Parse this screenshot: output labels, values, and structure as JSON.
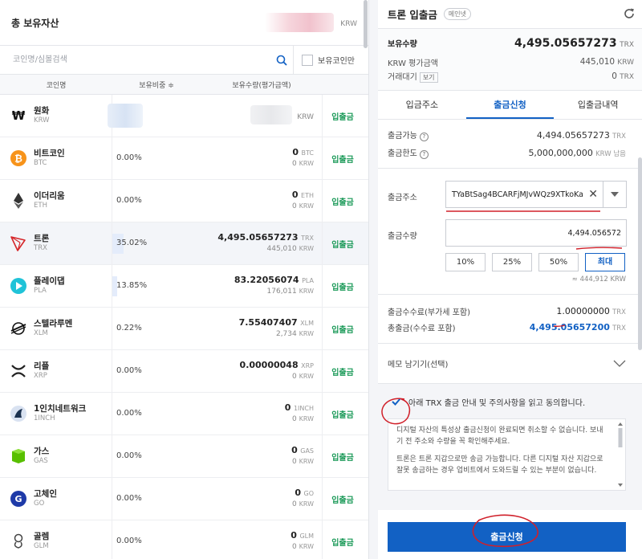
{
  "left": {
    "header_title": "총 보유자산",
    "header_currency": "KRW",
    "search_placeholder": "코인명/심볼검색",
    "owned_only_label": "보유코인만",
    "columns": [
      "코인명",
      "보유비중 ≑",
      "보유수량(평가금액)"
    ],
    "rows": [
      {
        "icon": "won-icon",
        "name": "원화",
        "symbol": "KRW",
        "ratio": "",
        "ratio_value": 0,
        "amount": "",
        "amount_unit": "",
        "value": "",
        "value_unit": "KRW",
        "action": "입출금",
        "masked": true
      },
      {
        "icon": "bitcoin-icon",
        "name": "비트코인",
        "symbol": "BTC",
        "ratio": "0.00%",
        "ratio_value": 0,
        "amount": "0",
        "amount_unit": "BTC",
        "value": "0",
        "value_unit": "KRW",
        "action": "입출금"
      },
      {
        "icon": "ethereum-icon",
        "name": "이더리움",
        "symbol": "ETH",
        "ratio": "0.00%",
        "ratio_value": 0,
        "amount": "0",
        "amount_unit": "ETH",
        "value": "0",
        "value_unit": "KRW",
        "action": "입출금"
      },
      {
        "icon": "tron-icon",
        "name": "트론",
        "symbol": "TRX",
        "ratio": "35.02%",
        "ratio_value": 35.02,
        "amount": "4,495.05657273",
        "amount_unit": "TRX",
        "value": "445,010",
        "value_unit": "KRW",
        "action": "입출금",
        "active": true
      },
      {
        "icon": "playdapp-icon",
        "name": "플레이댑",
        "symbol": "PLA",
        "ratio": "13.85%",
        "ratio_value": 13.85,
        "amount": "83.22056074",
        "amount_unit": "PLA",
        "value": "176,011",
        "value_unit": "KRW",
        "action": "입출금"
      },
      {
        "icon": "stellar-icon",
        "name": "스텔라루멘",
        "symbol": "XLM",
        "ratio": "0.22%",
        "ratio_value": 0.22,
        "amount": "7.55407407",
        "amount_unit": "XLM",
        "value": "2,734",
        "value_unit": "KRW",
        "action": "입출금"
      },
      {
        "icon": "ripple-icon",
        "name": "리플",
        "symbol": "XRP",
        "ratio": "0.00%",
        "ratio_value": 0,
        "amount": "0.00000048",
        "amount_unit": "XRP",
        "value": "0",
        "value_unit": "KRW",
        "action": "입출금"
      },
      {
        "icon": "1inch-icon",
        "name": "1인치네트워크",
        "symbol": "1INCH",
        "ratio": "0.00%",
        "ratio_value": 0,
        "amount": "0",
        "amount_unit": "1INCH",
        "value": "0",
        "value_unit": "KRW",
        "action": "입출금"
      },
      {
        "icon": "gas-icon",
        "name": "가스",
        "symbol": "GAS",
        "ratio": "0.00%",
        "ratio_value": 0,
        "amount": "0",
        "amount_unit": "GAS",
        "value": "0",
        "value_unit": "KRW",
        "action": "입출금"
      },
      {
        "icon": "gochain-icon",
        "name": "고체인",
        "symbol": "GO",
        "ratio": "0.00%",
        "ratio_value": 0,
        "amount": "0",
        "amount_unit": "GO",
        "value": "0",
        "value_unit": "KRW",
        "action": "입출금"
      },
      {
        "icon": "golem-icon",
        "name": "골렘",
        "symbol": "GLM",
        "ratio": "0.00%",
        "ratio_value": 0,
        "amount": "0",
        "amount_unit": "GLM",
        "value": "0",
        "value_unit": "KRW",
        "action": "입출금"
      }
    ]
  },
  "right": {
    "title": "트론 입출금",
    "badge": "메인넷",
    "balance_label": "보유수량",
    "balance_value": "4,495.05657273",
    "balance_unit": "TRX",
    "krw_label": "KRW 평가금액",
    "krw_value": "445,010",
    "krw_unit": "KRW",
    "pending_label": "거래대기",
    "pending_button": "보기",
    "pending_value": "0",
    "pending_unit": "TRX",
    "tabs": [
      "입금주소",
      "출금신청",
      "입출금내역"
    ],
    "available_label": "출금가능",
    "available_value": "4,494.05657273",
    "available_unit": "TRX",
    "limit_label": "출금한도",
    "limit_value": "5,000,000,000",
    "limit_unit": "KRW 남음",
    "address_label": "출금주소",
    "address_value": "TYaBtSag4BCARFjMJvWQz9XTkoKa",
    "qty_label": "출금수량",
    "qty_value": "4,494.056572",
    "pct_buttons": [
      "10%",
      "25%",
      "50%",
      "최대"
    ],
    "approx": "≈ 444,912 KRW",
    "fee_label": "출금수수료(부가세 포함)",
    "fee_value": "1.00000000",
    "fee_unit": "TRX",
    "total_label": "총출금(수수료 포함)",
    "total_value": "4,495.05657200",
    "total_unit": "TRX",
    "memo_label": "메모 남기기(선택)",
    "agree_text": "아래 TRX 출금 안내 및 주의사항을 읽고 동의합니다.",
    "notice_1": "디지털 자산의 특성상 출금신청이 완료되면 취소할 수 없습니다. 보내기 전 주소와 수량을 꼭 확인해주세요.",
    "notice_2": "트론은 트론 지갑으로만 송금 가능합니다. 다른 디지털 자산 지갑으로 잘못 송금하는 경우 업비트에서 도와드릴 수 있는 부분이 없습니다.",
    "submit": "출금신청"
  },
  "colors": {
    "accent": "#1261c4",
    "green": "#1c9a59",
    "annotation": "#d0202a"
  }
}
